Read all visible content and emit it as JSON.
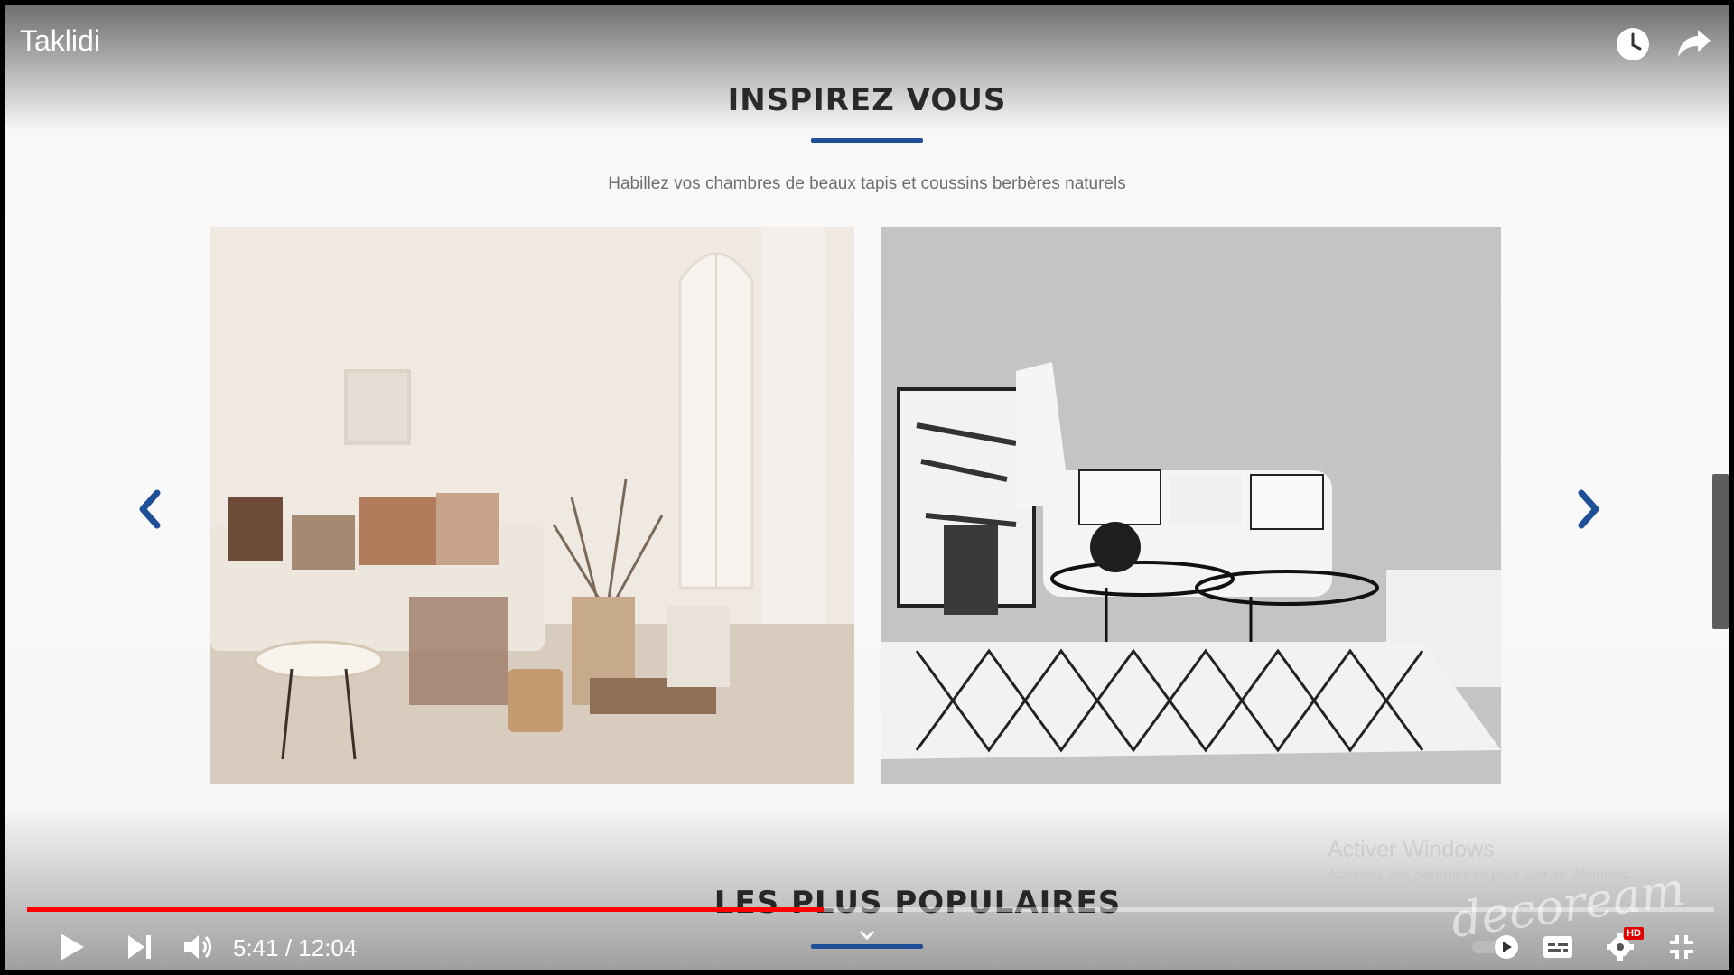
{
  "video": {
    "title": "Taklidi",
    "current_time": "5:41",
    "duration": "12:04",
    "time_display": "5:41 / 12:04",
    "progress": 0.4723,
    "hd_badge": "HD"
  },
  "page": {
    "section_title": "INSPIREZ VOUS",
    "subtitle": "Habillez vos chambres de beaux tapis et coussins berbères naturels",
    "next_section_title": "LES PLUS POPULAIRES"
  },
  "overlay": {
    "watermark_line1": "Activer Windows",
    "watermark_line2": "Accédez aux paramètres pour activer Windows.",
    "channel_logo_text": "decoream"
  },
  "icons": {
    "watch_later": "clock-icon",
    "share": "share-icon",
    "prev": "chevron-left-icon",
    "next": "chevron-right-icon",
    "play": "play-icon",
    "skip": "skip-next-icon",
    "volume": "volume-icon",
    "autoplay": "autoplay-toggle-icon",
    "subtitles": "subtitles-icon",
    "settings": "gear-icon",
    "fullscreen_exit": "exit-fullscreen-icon"
  },
  "colors": {
    "accent_blue": "#1f4f97",
    "progress_red": "#ff0000",
    "title_text": "#2f2f2f"
  }
}
